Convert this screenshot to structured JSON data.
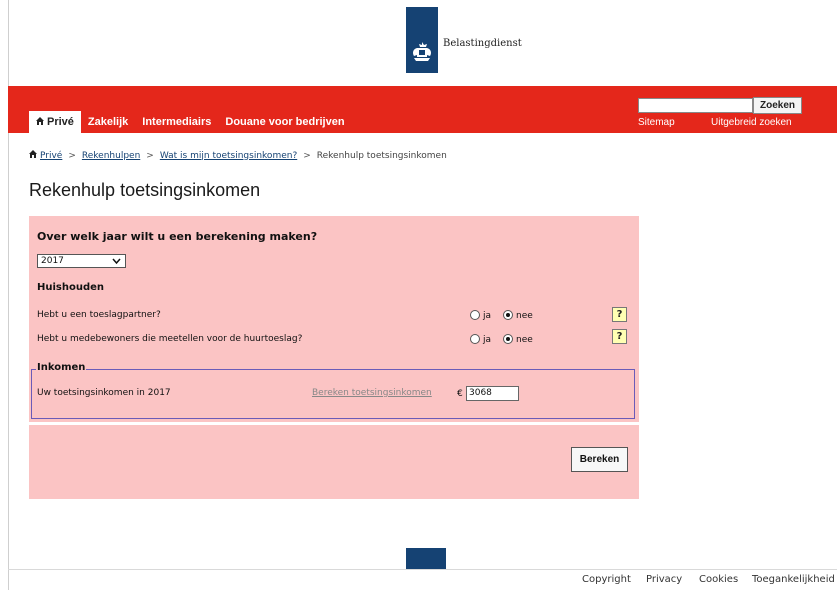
{
  "brand": {
    "name": "Belastingdienst",
    "logo_color": "#154273",
    "accent": "#e4271b"
  },
  "nav": {
    "items": [
      "Privé",
      "Zakelijk",
      "Intermediairs",
      "Douane voor bedrijven"
    ],
    "active": "Privé"
  },
  "search": {
    "value": "",
    "button": "Zoeken"
  },
  "utility": {
    "sitemap": "Sitemap",
    "advanced": "Uitgebreid zoeken"
  },
  "breadcrumb": {
    "items": [
      "Privé",
      "Rekenhulpen",
      "Wat is mijn toetsingsinkomen?"
    ],
    "current": "Rekenhulp toetsingsinkomen",
    "separator": ">"
  },
  "page": {
    "title": "Rekenhulp toetsingsinkomen"
  },
  "form": {
    "year_question": "Over welk jaar wilt u een berekening maken?",
    "year_selected": "2017",
    "household_heading": "Huishouden",
    "q_partner": "Hebt u een toeslagpartner?",
    "q_residents": "Hebt u medebewoners die meetellen voor de huurtoeslag?",
    "yes": "ja",
    "no": "nee",
    "partner_answer": "nee",
    "residents_answer": "nee",
    "help": "?",
    "income_legend": "Inkomen",
    "income_label": "Uw toetsingsinkomen in 2017",
    "calc_link": "Bereken toetsingsinkomen",
    "currency": "€",
    "income_value": "3068",
    "submit": "Bereken"
  },
  "footer": {
    "links": [
      "Copyright",
      "Privacy",
      "Cookies",
      "Toegankelijkheid"
    ]
  },
  "colors": {
    "panel": "#fbc4c4",
    "red": "#e4271b",
    "navy": "#154273"
  }
}
